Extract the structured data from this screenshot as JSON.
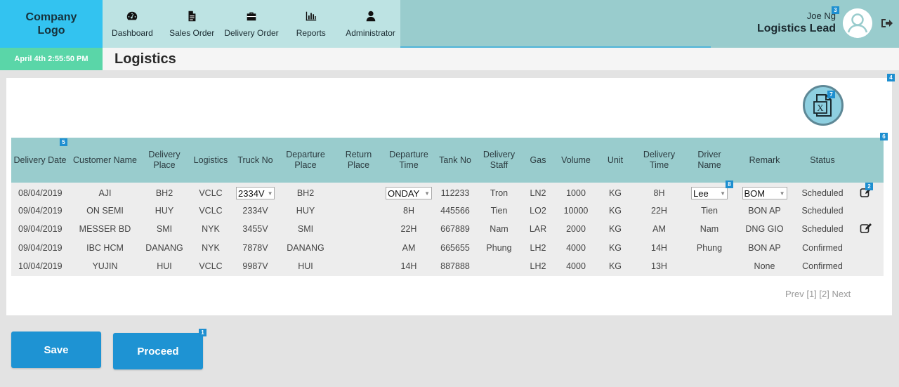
{
  "brand": {
    "logo": "Company Logo",
    "accent": "#33c3f0",
    "nav_bg": "#bde3e3",
    "top_bg": "#99cccd"
  },
  "nav": [
    {
      "label": "Dashboard",
      "icon": "dashboard-icon"
    },
    {
      "label": "Sales Order",
      "icon": "document-icon"
    },
    {
      "label": "Delivery Order",
      "icon": "briefcase-icon"
    },
    {
      "label": "Reports",
      "icon": "bar-chart-icon"
    },
    {
      "label": "Administrator",
      "icon": "user-icon"
    }
  ],
  "user": {
    "name": "Joe Ng",
    "role": "Logistics Lead"
  },
  "datetime": "April 4th 2:55:50 PM",
  "page_title": "Logistics",
  "badges": {
    "user": "3",
    "panel": "4",
    "excel": "7",
    "table": "6",
    "date_header": "5",
    "edit": "2",
    "driver": "8",
    "proceed": "1"
  },
  "table": {
    "headers": [
      "Delivery Date",
      "Customer Name",
      "Delivery Place",
      "Logistics",
      "Truck No",
      "Departure Place",
      "Return Place",
      "Departure Time",
      "Tank No",
      "Delivery Staff",
      "Gas",
      "Volume",
      "Unit",
      "Delivery Time",
      "Driver Name",
      "Remark",
      "Status"
    ],
    "rows": [
      {
        "date": "08/04/2019",
        "customer": "AJI",
        "place": "BH2",
        "logistics": "VCLC",
        "truck": "2334V",
        "departure": "BH2",
        "return": "",
        "dep_time": "ONDAY",
        "tank": "112233",
        "staff": "Tron",
        "gas": "LN2",
        "volume": "1000",
        "unit": "KG",
        "del_time": "8H",
        "driver": "Lee",
        "remark": "BOM",
        "status": "Scheduled"
      },
      {
        "date": "09/04/2019",
        "customer": "ON SEMI",
        "place": "HUY",
        "logistics": "VCLC",
        "truck": "2334V",
        "departure": "HUY",
        "return": "",
        "dep_time": "8H",
        "tank": "445566",
        "staff": "Tien",
        "gas": "LO2",
        "volume": "10000",
        "unit": "KG",
        "del_time": "22H",
        "driver": "Tien",
        "remark": "BON AP",
        "status": "Scheduled"
      },
      {
        "date": "09/04/2019",
        "customer": "MESSER BD",
        "place": "SMI",
        "logistics": "NYK",
        "truck": "3455V",
        "departure": "SMI",
        "return": "",
        "dep_time": "22H",
        "tank": "667889",
        "staff": "Nam",
        "gas": "LAR",
        "volume": "2000",
        "unit": "KG",
        "del_time": "AM",
        "driver": "Nam",
        "remark": "DNG GIO",
        "status": "Scheduled"
      },
      {
        "date": "09/04/2019",
        "customer": "IBC HCM",
        "place": "DANANG",
        "logistics": "NYK",
        "truck": "7878V",
        "departure": "DANANG",
        "return": "",
        "dep_time": "AM",
        "tank": "665655",
        "staff": "Phung",
        "gas": "LH2",
        "volume": "4000",
        "unit": "KG",
        "del_time": "14H",
        "driver": "Phung",
        "remark": "BON AP",
        "status": "Confirmed"
      },
      {
        "date": "10/04/2019",
        "customer": "YUJIN",
        "place": "HUI",
        "logistics": "VCLC",
        "truck": "9987V",
        "departure": "HUI",
        "return": "",
        "dep_time": "14H",
        "tank": "887888",
        "staff": "",
        "gas": "LH2",
        "volume": "4000",
        "unit": "KG",
        "del_time": "13H",
        "driver": "",
        "remark": "None",
        "status": "Confirmed"
      }
    ]
  },
  "pager": "Prev [1] [2] Next",
  "buttons": {
    "save": "Save",
    "proceed": "Proceed"
  },
  "excel_icon": "excel-export-icon",
  "excel_letter": "X"
}
